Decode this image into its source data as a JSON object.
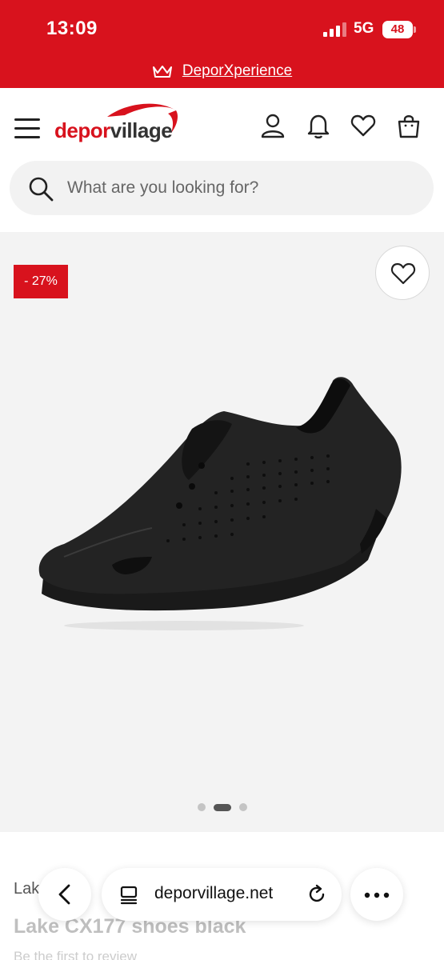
{
  "status_bar": {
    "time": "13:09",
    "network": "5G",
    "battery": "48",
    "icons": [
      "signal-icon",
      "battery-icon"
    ]
  },
  "promo": {
    "icon": "crown-icon",
    "link_label": "DeporXperience"
  },
  "header": {
    "logo_part1": "depor",
    "logo_part2": "village",
    "icons": [
      "menu-icon",
      "user-icon",
      "bell-icon",
      "heart-icon",
      "bag-icon"
    ]
  },
  "search": {
    "placeholder": "What are you looking for?"
  },
  "product": {
    "discount": "- 27%",
    "image_count": 3,
    "active_image": 2,
    "brand": "Lake",
    "name": "Lake CX177 shoes black",
    "review_text": "Be the first to review"
  },
  "browser": {
    "url": "deporvillage.net",
    "icons": [
      "back-icon",
      "tabs-icon",
      "reload-icon",
      "more-icon"
    ]
  },
  "colors": {
    "brand_red": "#d8121d",
    "gallery_bg": "#f3f3f3"
  }
}
